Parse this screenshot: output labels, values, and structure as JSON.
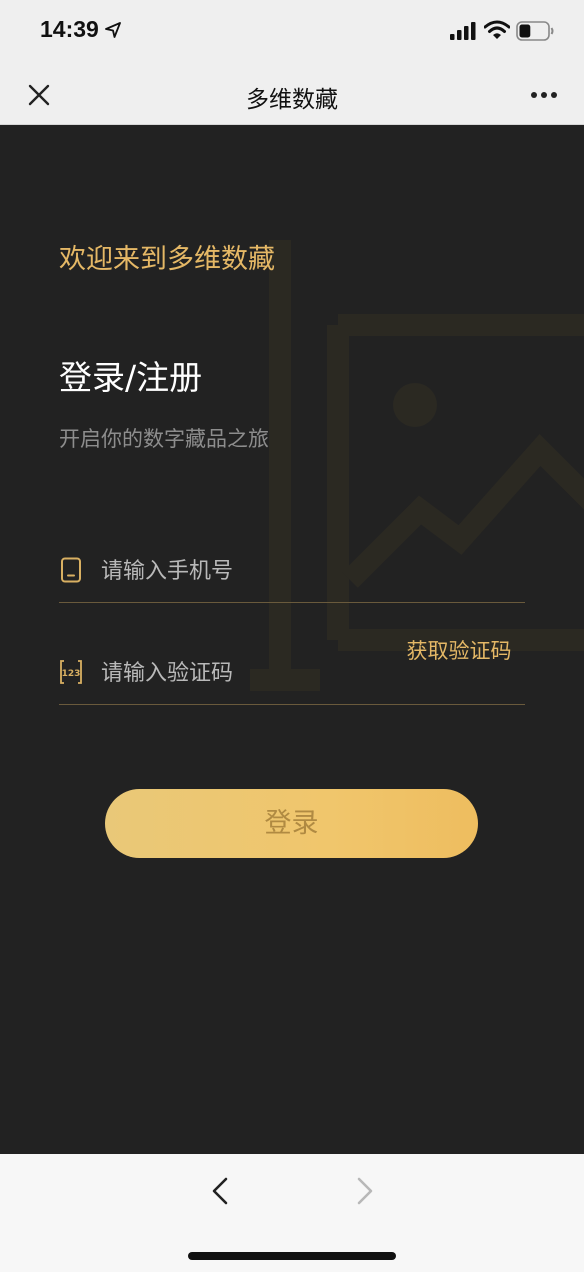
{
  "status_bar": {
    "time": "14:39",
    "battery_level": 0.4
  },
  "nav": {
    "title": "多维数藏"
  },
  "page": {
    "welcome": "欢迎来到多维数藏",
    "heading": "登录/注册",
    "subtitle": "开启你的数字藏品之旅"
  },
  "form": {
    "phone_placeholder": "请输入手机号",
    "code_placeholder": "请输入验证码",
    "get_code_label": "获取验证码",
    "code_icon_text": "123",
    "login_label": "登录"
  },
  "colors": {
    "background": "#222222",
    "accent_gold": "#e5b866",
    "button_gradient_start": "#e9c878",
    "button_gradient_end": "#eebd5f"
  },
  "icons": [
    "location-arrow-icon",
    "signal-icon",
    "wifi-icon",
    "battery-icon",
    "close-icon",
    "more-icon",
    "phone-icon",
    "code-icon",
    "chevron-left-icon",
    "chevron-right-icon"
  ]
}
